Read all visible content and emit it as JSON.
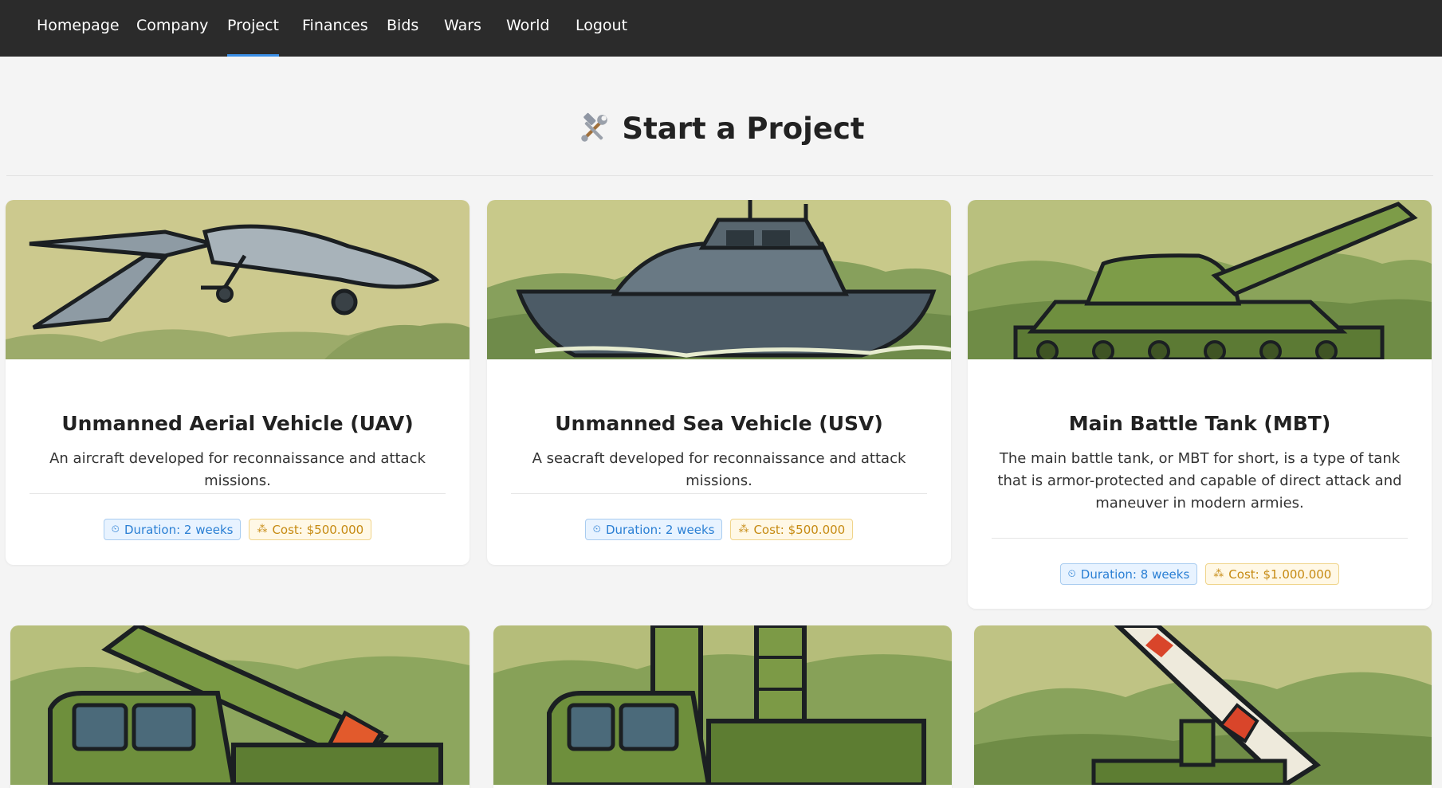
{
  "nav": {
    "items": [
      {
        "label": "Homepage"
      },
      {
        "label": "Company"
      },
      {
        "label": "Project",
        "active": true
      },
      {
        "label": "Finances"
      },
      {
        "label": "Bids"
      },
      {
        "label": "Wars"
      },
      {
        "label": "World"
      },
      {
        "label": "Logout"
      }
    ],
    "active_color": "#3a8ee6"
  },
  "page": {
    "title": "Start a Project",
    "title_icon": "hammer-and-wrench-icon"
  },
  "projects": [
    {
      "title": "Unmanned Aerial Vehicle (UAV)",
      "description": "An aircraft developed for reconnaissance and attack missions.",
      "duration": "Duration: 2 weeks",
      "cost": "Cost: $500.000",
      "image": "uav-drone-illustration"
    },
    {
      "title": "Unmanned Sea Vehicle (USV)",
      "description": "A seacraft developed for reconnaissance and attack missions.",
      "duration": "Duration: 2 weeks",
      "cost": "Cost: $500.000",
      "image": "usv-boat-illustration"
    },
    {
      "title": "Main Battle Tank (MBT)",
      "description": "The main battle tank, or MBT for short, is a type of tank that is armor-protected and capable of direct attack and maneuver in modern armies.",
      "duration": "Duration: 8 weeks",
      "cost": "Cost: $1.000.000",
      "image": "tank-illustration"
    },
    {
      "image": "missile-launcher-truck-illustration"
    },
    {
      "image": "air-defense-truck-illustration"
    },
    {
      "image": "missile-launcher-illustration"
    }
  ],
  "colors": {
    "navbar": "#2b2b2b",
    "duration_badge": "#2a7fd4",
    "cost_badge": "#c68a12",
    "illustration_bg": "#c9c98a"
  }
}
